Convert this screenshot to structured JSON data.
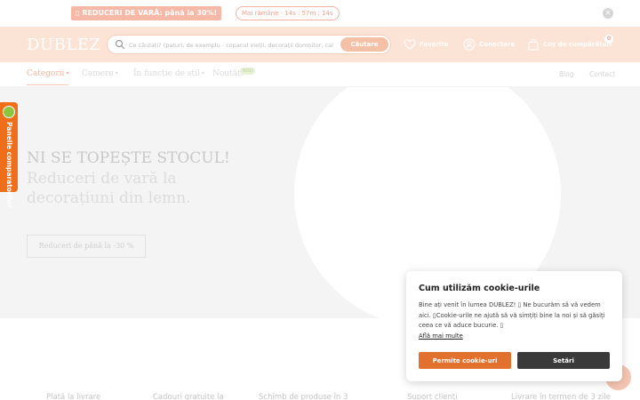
{
  "promo": {
    "label": "▯ REDUCERI DE VARĂ: până la 30%!",
    "countdown": "Mai rămâne · 14s : 57m : 14s",
    "close_icon": "close-icon"
  },
  "header": {
    "logo": "DUBLEZ",
    "search_placeholder": "Ce căutați? (paturi, de exemplu - copacul vieții, decorații domnitor, cai",
    "search_button": "Căutare",
    "favorites": "Favorite",
    "account": "Conectare",
    "cart": "Coș de cumpărături",
    "cart_count": "0"
  },
  "nav": {
    "items": [
      {
        "label": "Categorii"
      },
      {
        "label": "Camere"
      },
      {
        "label": "În funcție de stil"
      },
      {
        "label": "Noutăți"
      }
    ],
    "new_badge": "NOU",
    "right": [
      "Blog",
      "Contact"
    ]
  },
  "hero": {
    "eyebrow": "NI SE TOPEȘTE STOCUL!",
    "title": "Reduceri de vară la decorațiuni din lemn.",
    "cta": "Reduceri de până la -30 %"
  },
  "compare_tab": {
    "label": "Panelle comparatorilor"
  },
  "features": [
    "Plată la livrare",
    "Cadouri gratuite la",
    "Schimb de produse în 3",
    "Suport clienți",
    "Livrare în termen de 3 zile"
  ],
  "cookie": {
    "title": "Cum utilizăm cookie-urile",
    "text": "Bine ați venit în lumea DUBLEZ! ▯ Ne bucurăm să vă vedem aici. ▯Cookie-urile ne ajută să vă simțiți bine la noi și să găsiți ceea ce vă aduce bucurie. ▯",
    "link": "Află mai multe",
    "accept": "Permite cookie-uri",
    "settings": "Setări"
  },
  "colors": {
    "accent": "#e2702e",
    "header_bg": "#fbe3d6",
    "compare_tab": "#ee6e1a",
    "settings_btn": "#3a3a3a"
  }
}
